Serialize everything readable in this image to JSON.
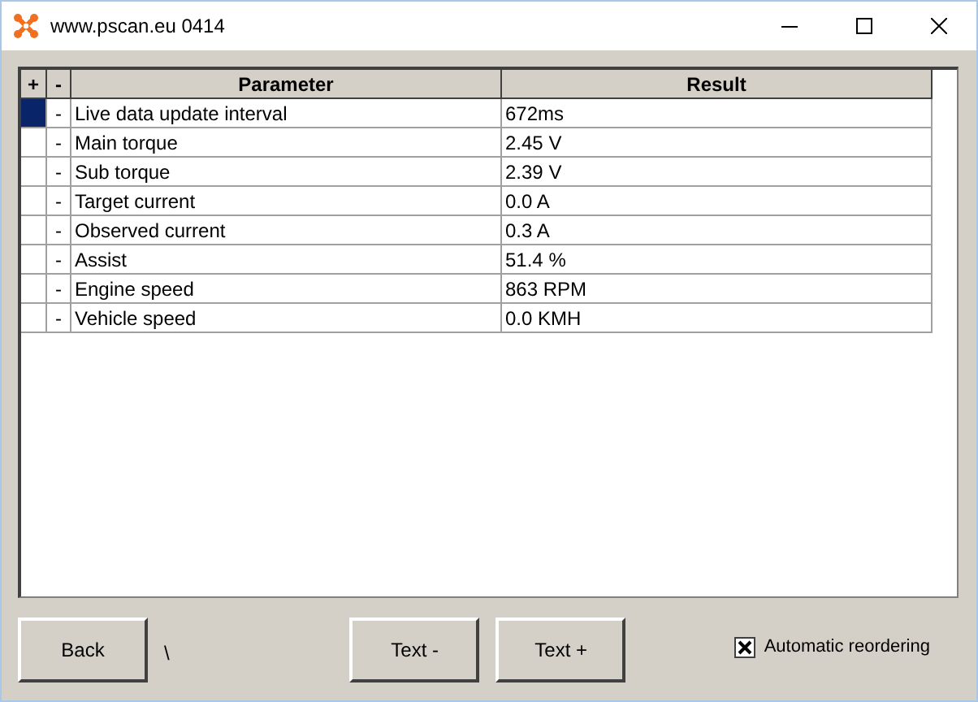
{
  "window": {
    "title": "www.pscan.eu 0414"
  },
  "table": {
    "columns": [
      "+",
      "-",
      "Parameter",
      "Result"
    ],
    "rows": [
      {
        "marker": "-",
        "parameter": "Live data update interval",
        "result": "672ms",
        "selected": true
      },
      {
        "marker": "-",
        "parameter": "Main torque",
        "result": "2.45 V",
        "selected": false
      },
      {
        "marker": "-",
        "parameter": "Sub torque",
        "result": "2.39 V",
        "selected": false
      },
      {
        "marker": "-",
        "parameter": "Target current",
        "result": "0.0 A",
        "selected": false
      },
      {
        "marker": "-",
        "parameter": "Observed current",
        "result": "0.3 A",
        "selected": false
      },
      {
        "marker": "-",
        "parameter": "Assist",
        "result": "51.4 %",
        "selected": false
      },
      {
        "marker": "-",
        "parameter": "Engine speed",
        "result": "863 RPM",
        "selected": false
      },
      {
        "marker": "-",
        "parameter": "Vehicle speed",
        "result": "0.0 KMH",
        "selected": false
      }
    ]
  },
  "buttons": {
    "back": "Back",
    "path": "\\",
    "text_minus": "Text -",
    "text_plus": "Text +"
  },
  "auto_reorder": {
    "label": "Automatic reordering",
    "checked": true
  }
}
